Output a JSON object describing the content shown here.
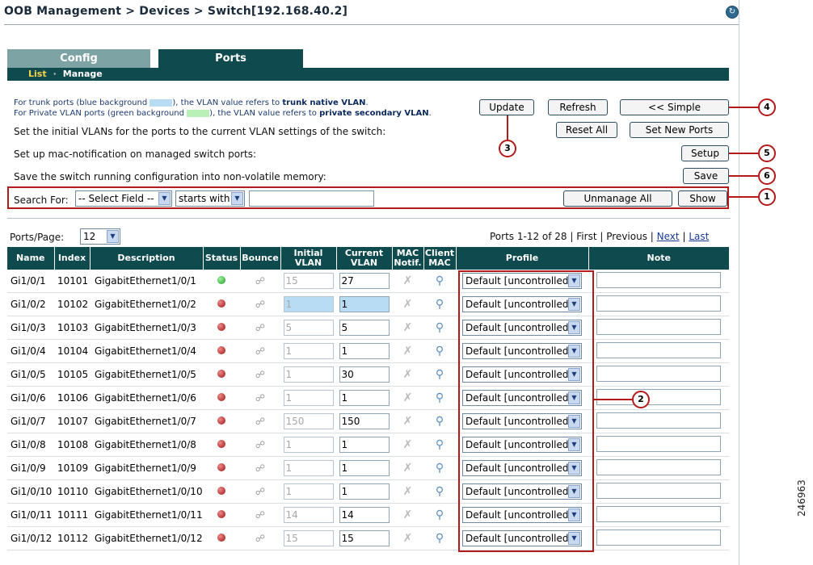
{
  "header": {
    "breadcrumb": "OOB Management > Devices > Switch[192.168.40.2]",
    "help_icon": "help-icon"
  },
  "tabs": [
    {
      "label": "Config"
    },
    {
      "label": "Ports"
    }
  ],
  "subnav": {
    "list": "List",
    "separator": "·",
    "manage": "Manage"
  },
  "notes": {
    "trunk_prefix": "For trunk ports (blue background",
    "trunk_suffix": "), the VLAN value refers to",
    "trunk_bold": "trunk native VLAN",
    "trunk_end": ".",
    "pvlan_prefix": "For Private VLAN ports (green background",
    "pvlan_suffix": "), the VLAN value refers to",
    "pvlan_bold": "private secondary VLAN",
    "pvlan_end": "."
  },
  "actions": {
    "initial_vlans_text": "Set the initial VLANs for the ports to the current VLAN settings of the switch:",
    "mac_notification_text": "Set up mac-notification on managed switch ports:",
    "save_config_text": "Save the switch running configuration into non-volatile memory:",
    "update": "Update",
    "refresh": "Refresh",
    "simple": "<< Simple",
    "reset_all": "Reset All",
    "set_new_ports": "Set New Ports",
    "setup": "Setup",
    "save": "Save"
  },
  "search": {
    "label": "Search For:",
    "field_select": "-- Select Field --",
    "operator_select": "starts with",
    "value": "",
    "unmanage_all": "Unmanage All",
    "show": "Show"
  },
  "paging": {
    "ports_per_page_label": "Ports/Page:",
    "ports_per_page": "12",
    "range": "Ports 1-12 of 28",
    "first": "First",
    "previous": "Previous",
    "next": "Next",
    "last": "Last",
    "sep": "|"
  },
  "columns": [
    "Name",
    "Index",
    "Description",
    "Status",
    "Bounce",
    "Initial VLAN",
    "Current VLAN",
    "MAC Notif.",
    "Client MAC",
    "Profile",
    "Note"
  ],
  "rows": [
    {
      "name": "Gi1/0/1",
      "index": "10101",
      "desc": "GigabitEthernet1/0/1",
      "status": "green",
      "initial": "15",
      "current": "27",
      "profile": "Default [uncontrolled]",
      "trunk": false
    },
    {
      "name": "Gi1/0/2",
      "index": "10102",
      "desc": "GigabitEthernet1/0/2",
      "status": "red",
      "initial": "1",
      "current": "1",
      "profile": "Default [uncontrolled]",
      "trunk": true
    },
    {
      "name": "Gi1/0/3",
      "index": "10103",
      "desc": "GigabitEthernet1/0/3",
      "status": "red",
      "initial": "5",
      "current": "5",
      "profile": "Default [uncontrolled]",
      "trunk": false
    },
    {
      "name": "Gi1/0/4",
      "index": "10104",
      "desc": "GigabitEthernet1/0/4",
      "status": "red",
      "initial": "1",
      "current": "1",
      "profile": "Default [uncontrolled]",
      "trunk": false
    },
    {
      "name": "Gi1/0/5",
      "index": "10105",
      "desc": "GigabitEthernet1/0/5",
      "status": "red",
      "initial": "1",
      "current": "30",
      "profile": "Default [uncontrolled]",
      "trunk": false
    },
    {
      "name": "Gi1/0/6",
      "index": "10106",
      "desc": "GigabitEthernet1/0/6",
      "status": "red",
      "initial": "1",
      "current": "1",
      "profile": "Default [uncontrolled]",
      "trunk": false
    },
    {
      "name": "Gi1/0/7",
      "index": "10107",
      "desc": "GigabitEthernet1/0/7",
      "status": "red",
      "initial": "150",
      "current": "150",
      "profile": "Default [uncontrolled]",
      "trunk": false
    },
    {
      "name": "Gi1/0/8",
      "index": "10108",
      "desc": "GigabitEthernet1/0/8",
      "status": "red",
      "initial": "1",
      "current": "1",
      "profile": "Default [uncontrolled]",
      "trunk": false
    },
    {
      "name": "Gi1/0/9",
      "index": "10109",
      "desc": "GigabitEthernet1/0/9",
      "status": "red",
      "initial": "1",
      "current": "1",
      "profile": "Default [uncontrolled]",
      "trunk": false
    },
    {
      "name": "Gi1/0/10",
      "index": "10110",
      "desc": "GigabitEthernet1/0/10",
      "status": "red",
      "initial": "1",
      "current": "1",
      "profile": "Default [uncontrolled]",
      "trunk": false
    },
    {
      "name": "Gi1/0/11",
      "index": "10111",
      "desc": "GigabitEthernet1/0/11",
      "status": "red",
      "initial": "14",
      "current": "14",
      "profile": "Default [uncontrolled]",
      "trunk": false
    },
    {
      "name": "Gi1/0/12",
      "index": "10112",
      "desc": "GigabitEthernet1/0/12",
      "status": "red",
      "initial": "15",
      "current": "15",
      "profile": "Default [uncontrolled]",
      "trunk": false
    }
  ],
  "callouts": [
    "1",
    "2",
    "3",
    "4",
    "5",
    "6"
  ],
  "figure_id": "246963",
  "colors": {
    "header_teal": "#0f4a4e",
    "tab_inactive": "#7ea3a5",
    "callout_red": "#b31b1b",
    "trunk_blue": "#b9dcf5",
    "pvlan_green": "#b8f0b8",
    "active_nav": "#f7d54a"
  }
}
